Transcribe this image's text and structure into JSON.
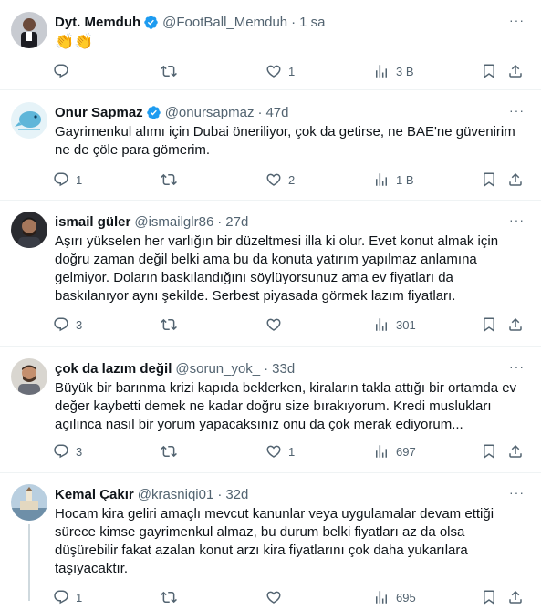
{
  "tweets": [
    {
      "name": "Dyt. Memduh",
      "verified": true,
      "handle": "@FootBall_Memduh",
      "time": "1 sa",
      "text": "👏👏",
      "replies": "",
      "retweets": "",
      "likes": "1",
      "views": "3 B"
    },
    {
      "name": "Onur Sapmaz",
      "verified": true,
      "handle": "@onursapmaz",
      "time": "47d",
      "text": "Gayrimenkul alımı için Dubai öneriliyor, çok da getirse, ne BAE'ne güvenirim ne de çöle para gömerim.",
      "replies": "1",
      "retweets": "",
      "likes": "2",
      "views": "1 B"
    },
    {
      "name": "ismail güler",
      "verified": false,
      "handle": "@ismailglr86",
      "time": "27d",
      "text": "Aşırı yükselen her varlığın bir düzeltmesi illa ki olur. Evet konut almak için doğru zaman değil belki ama bu da konuta yatırım yapılmaz anlamına gelmiyor. Doların baskılandığını söylüyorsunuz ama ev fiyatları da baskılanıyor aynı şekilde. Serbest piyasada görmek lazım fiyatları.",
      "replies": "3",
      "retweets": "",
      "likes": "",
      "views": "301"
    },
    {
      "name": "çok da lazım değil",
      "verified": false,
      "handle": "@sorun_yok_",
      "time": "33d",
      "text": "Büyük bir barınma krizi kapıda beklerken, kiraların takla attığı bir ortamda ev değer kaybetti demek ne kadar doğru size bırakıyorum. Kredi muslukları açılınca nasıl bir yorum yapacaksınız onu da çok merak ediyorum...",
      "replies": "3",
      "retweets": "",
      "likes": "1",
      "views": "697"
    },
    {
      "name": "Kemal Çakır",
      "verified": false,
      "handle": "@krasniqi01",
      "time": "32d",
      "text": "Hocam kira geliri amaçlı mevcut kanunlar veya uygulamalar devam ettiği sürece kimse gayrimenkul almaz, bu durum belki fiyatları az da olsa düşürebilir fakat azalan konut arzı kira fiyatlarını çok daha yukarılara taşıyacaktır.",
      "replies": "1",
      "retweets": "",
      "likes": "",
      "views": "695"
    }
  ],
  "ui": {
    "dot": "·",
    "more": "···"
  },
  "colors": {
    "verified": "#1d9bf0",
    "muted": "#536471",
    "divider": "#eff3f4"
  }
}
